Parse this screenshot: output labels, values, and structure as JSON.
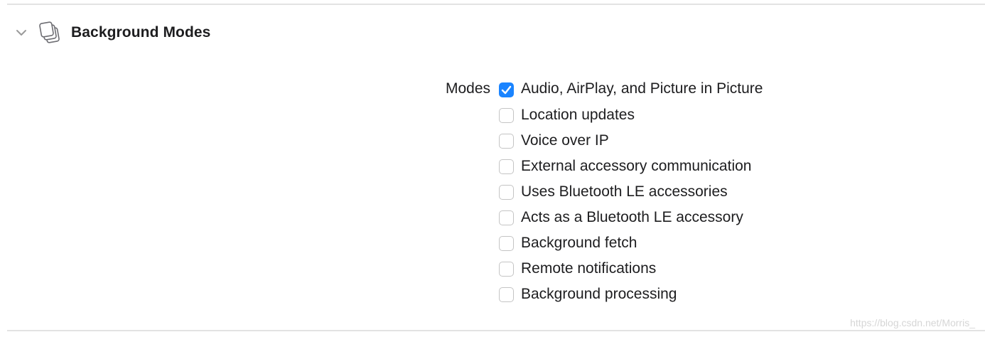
{
  "section": {
    "title": "Background Modes",
    "expanded": true,
    "disclosure_icon": "chevron-down-icon",
    "capability_icon": "stacked-layers-icon"
  },
  "modes_label": "Modes",
  "modes": [
    {
      "label": "Audio, AirPlay, and Picture in Picture",
      "checked": true
    },
    {
      "label": "Location updates",
      "checked": false
    },
    {
      "label": "Voice over IP",
      "checked": false
    },
    {
      "label": "External accessory communication",
      "checked": false
    },
    {
      "label": "Uses Bluetooth LE accessories",
      "checked": false
    },
    {
      "label": "Acts as a Bluetooth LE accessory",
      "checked": false
    },
    {
      "label": "Background fetch",
      "checked": false
    },
    {
      "label": "Remote notifications",
      "checked": false
    },
    {
      "label": "Background processing",
      "checked": false
    }
  ],
  "watermark": "https://blog.csdn.net/Morris_",
  "colors": {
    "accent": "#1a84ff",
    "text": "#1d1d1f",
    "separator": "#e3e3e3"
  }
}
